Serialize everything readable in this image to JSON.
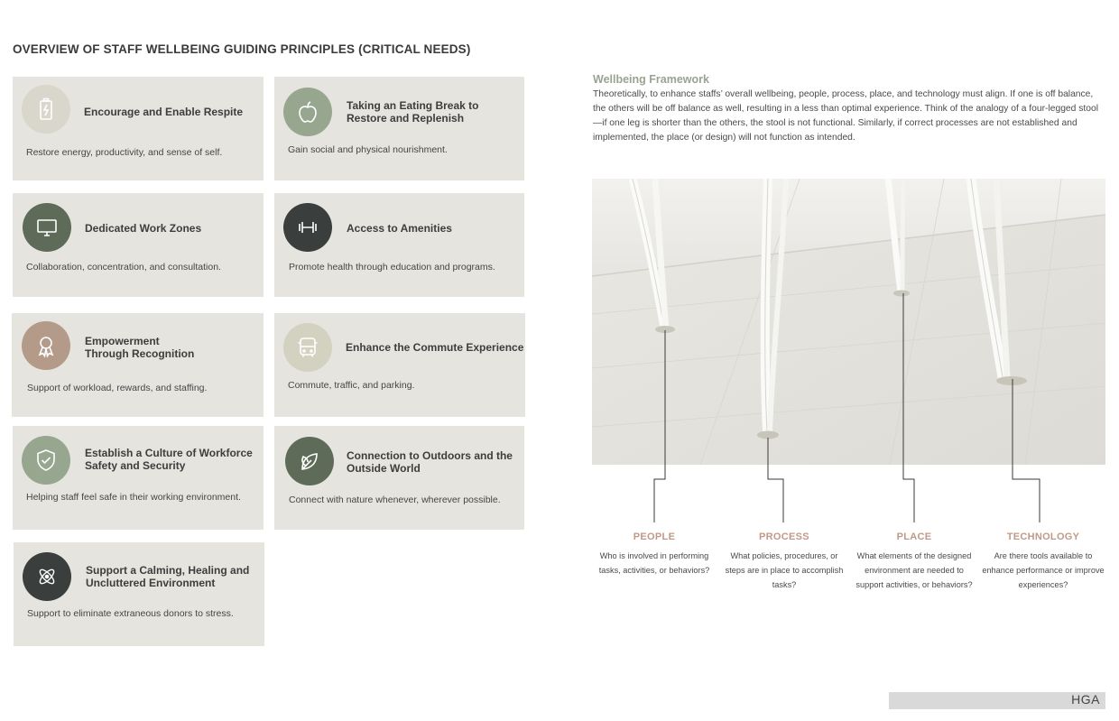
{
  "page_title": "OVERVIEW OF STAFF WELLBEING GUIDING PRINCIPLES  (CRITICAL NEEDS)",
  "principles": [
    {
      "title": "Encourage and Enable Respite",
      "desc": "Restore energy, productivity, and sense of self.",
      "icon": "battery-icon",
      "color": "#d9d6cb"
    },
    {
      "title": "Taking an Eating Break to\nRestore and Replenish",
      "desc": "Gain social and physical nourishment.",
      "icon": "apple-icon",
      "color": "#97a68f"
    },
    {
      "title": "Dedicated Work Zones",
      "desc": "Collaboration, concentration, and consultation.",
      "icon": "monitor-icon",
      "color": "#5d6b58"
    },
    {
      "title": "Access to Amenities",
      "desc": "Promote health through education and programs.",
      "icon": "dumbbell-icon",
      "color": "#3a3f3e"
    },
    {
      "title": "Empowerment\nThrough Recognition",
      "desc": "Support of workload, rewards, and staffing.",
      "icon": "award-ribbon-icon",
      "color": "#b39a89"
    },
    {
      "title": "Enhance the Commute Experience",
      "desc": "Commute, traffic, and parking.",
      "icon": "bus-icon",
      "color": "#d3d1c0"
    },
    {
      "title": "Establish a Culture of Workforce\nSafety and Security",
      "desc": "Helping staff feel safe in their working environment.",
      "icon": "shield-check-icon",
      "color": "#97a68f"
    },
    {
      "title": "Connection to Outdoors and the\nOutside World",
      "desc": "Connect with nature whenever, wherever possible.",
      "icon": "leaf-icon",
      "color": "#5d6b58"
    },
    {
      "title": "Support a Calming, Healing and\nUncluttered Environment",
      "desc": "Support to eliminate extraneous donors to stress.",
      "icon": "atom-icon",
      "color": "#3a3f3e"
    }
  ],
  "framework": {
    "title": "Wellbeing Framework",
    "body": "Theoretically, to enhance staffs’ overall wellbeing, people, process, place, and technology must align. If one is off balance, the others will be off balance as well, resulting in a less than optimal experience. Think of the analogy of a four-legged stool—if one leg is shorter than the others, the stool is not functional. Similarly, if correct processes are not established and implemented, the place (or design) will not function as intended."
  },
  "legs": [
    {
      "head": "PEOPLE",
      "question": "Who is involved in performing tasks, activities, or behaviors?"
    },
    {
      "head": "PROCESS",
      "question": "What policies, procedures, or steps are in place to accomplish tasks?"
    },
    {
      "head": "PLACE",
      "question": "What elements of the designed environment are needed to support activities, or behaviors?"
    },
    {
      "head": "TECHNOLOGY",
      "question": "Are there tools available to enhance performance or improve experiences?"
    }
  ],
  "footer": {
    "logo": "HGA"
  }
}
